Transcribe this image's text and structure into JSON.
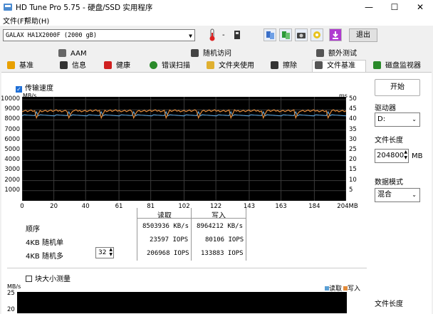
{
  "window": {
    "title": "HD Tune Pro 5.75 - 硬盘/SSD 实用程序",
    "minimize": "—",
    "maximize": "☐",
    "close": "✕"
  },
  "menu": {
    "file": "文件(F)",
    "help": "帮助(H)"
  },
  "toolbar": {
    "drive": "GALAX HA1X2000F (2000 gB)",
    "temperature": "-",
    "exit": "退出"
  },
  "tabs": {
    "top": [
      "AAM",
      "随机访问",
      "额外测试"
    ],
    "bottom": [
      "基准",
      "信息",
      "健康",
      "错误扫描",
      "文件夹使用",
      "擦除",
      "文件基准",
      "磁盘监视器"
    ],
    "active": "文件基准"
  },
  "transfer": {
    "checkbox_label": "传输速度",
    "left_unit": "MB/s",
    "right_unit": "ms",
    "left_ticks": [
      "10000",
      "9000",
      "8000",
      "7000",
      "6000",
      "5000",
      "4000",
      "3000",
      "2000",
      "1000"
    ],
    "right_ticks": [
      "50",
      "45",
      "40",
      "35",
      "30",
      "25",
      "20",
      "15",
      "10",
      "5"
    ],
    "x_ticks": [
      "0",
      "20",
      "40",
      "61",
      "81",
      "102",
      "122",
      "143",
      "163",
      "184",
      "204MB"
    ]
  },
  "results": {
    "read_header": "读取",
    "write_header": "写入",
    "rows": [
      {
        "label": "顺序",
        "read": "8503936 KB/s",
        "write": "8964212 KB/s"
      },
      {
        "label": "4KB 随机单",
        "read": "23597 IOPS",
        "write": "80106 IOPS"
      },
      {
        "label": "4KB 随机多",
        "read": "206968 IOPS",
        "write": "133883 IOPS"
      }
    ],
    "queue_depth": "32"
  },
  "block": {
    "checkbox_label": "块大小测量",
    "unit": "MB/s",
    "top_tick": "25",
    "bottom_tick": "20",
    "legend_read": "读取",
    "legend_write": "写入"
  },
  "side": {
    "start": "开始",
    "drive_label": "驱动器",
    "drive_value": "D:",
    "length_label": "文件长度",
    "length_value": "204800",
    "length_unit": "MB",
    "pattern_label": "数据模式",
    "pattern_value": "混合",
    "length_label2": "文件长度"
  },
  "chart_data": {
    "type": "line",
    "x": [
      0,
      20,
      40,
      61,
      81,
      102,
      122,
      143,
      163,
      184,
      204
    ],
    "xlabel": "MB",
    "ylabel": "MB/s",
    "ylim": [
      0,
      10000
    ],
    "y2lim": [
      0,
      50
    ],
    "series": [
      {
        "name": "",
        "values": [
          8450,
          8450,
          8450,
          8450,
          8450,
          8450,
          8450,
          8450,
          8450,
          8450,
          8450
        ],
        "color": "#5a9fd4"
      },
      {
        "name": "",
        "values": [
          8900,
          8900,
          8900,
          8900,
          8900,
          8900,
          8900,
          8900,
          8900,
          8900,
          8900
        ],
        "color": "#e38b3a"
      }
    ]
  },
  "colors": {
    "chart_bg": "#000000",
    "read": "#5a9fd4",
    "write": "#e38b3a",
    "grid": "#3a3a3a"
  }
}
